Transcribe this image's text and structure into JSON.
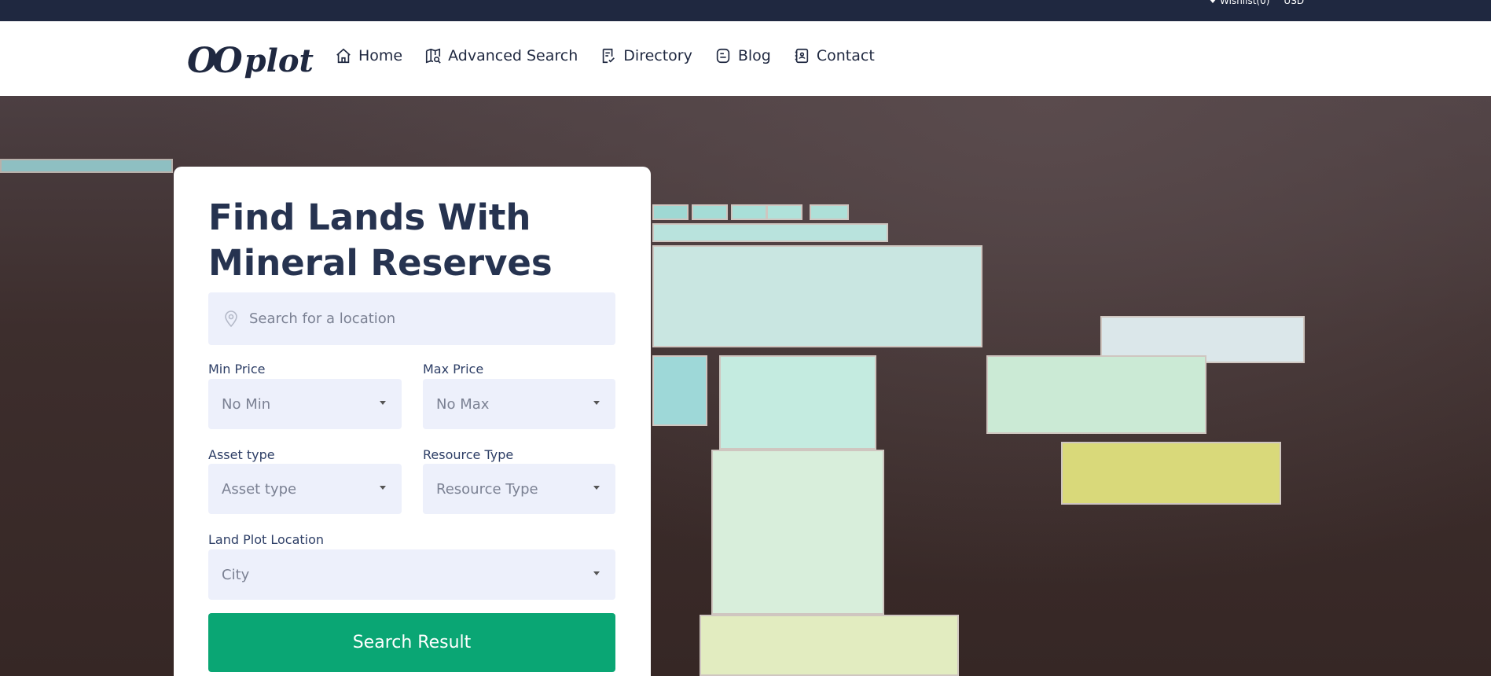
{
  "topbar": {
    "wishlist": "Wishlist(0)",
    "currency": "USD"
  },
  "logo": {
    "mark": "OO",
    "word": "plot"
  },
  "nav": {
    "items": [
      {
        "label": "Home",
        "icon": "home-icon"
      },
      {
        "label": "Advanced Search",
        "icon": "map-search-icon"
      },
      {
        "label": "Directory",
        "icon": "directory-icon"
      },
      {
        "label": "Blog",
        "icon": "blog-icon"
      },
      {
        "label": "Contact",
        "icon": "contact-icon"
      }
    ]
  },
  "search_card": {
    "title": "Find Lands With Mineral Reserves",
    "location_placeholder": "Search for a location",
    "min_price": {
      "label": "Min Price",
      "value": "No Min"
    },
    "max_price": {
      "label": "Max Price",
      "value": "No Max"
    },
    "asset_type": {
      "label": "Asset type",
      "value": "Asset type"
    },
    "resource_type": {
      "label": "Resource Type",
      "value": "Resource Type"
    },
    "land_plot_location": {
      "label": "Land Plot Location",
      "value": "City"
    },
    "submit_label": "Search Result"
  },
  "colors": {
    "topbar": "#1f2840",
    "primary_text": "#263350",
    "field_bg": "#edf0fb",
    "button": "#0aa674"
  }
}
